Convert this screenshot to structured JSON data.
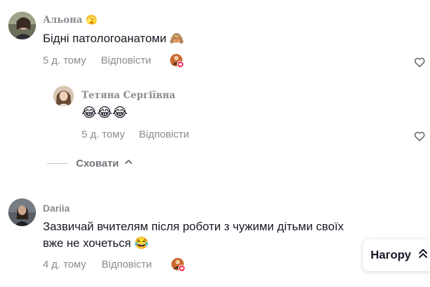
{
  "comments": [
    {
      "username": "Альона 🫣",
      "text": "Бідні патологоанатоми 🙈",
      "date": "5 д. тому",
      "reply_label": "Відповісти",
      "replies": [
        {
          "username": "Тетяна Сергіївна",
          "text": "😂😂😂",
          "date": "5 д. тому",
          "reply_label": "Відповісти"
        }
      ],
      "hide_replies_label": "Сховати"
    },
    {
      "username": "Dariia",
      "text_line1": "Зазвичай вчителям після роботи з чужими дітьми своїх",
      "text_line2": "вже не хочеться 😂",
      "date": "4 д. тому",
      "reply_label": "Відповісти"
    }
  ],
  "back_to_top_label": "Нагору",
  "icons": {
    "like": "heart-outline-icon",
    "creator_liked": "creator-liked-badge-icon",
    "chevron": "chevron-up-icon",
    "to_top": "arrow-up-icon"
  },
  "colors": {
    "text": "#161823",
    "muted": "#8a8b91",
    "creator_heart": "#fe2c55"
  }
}
